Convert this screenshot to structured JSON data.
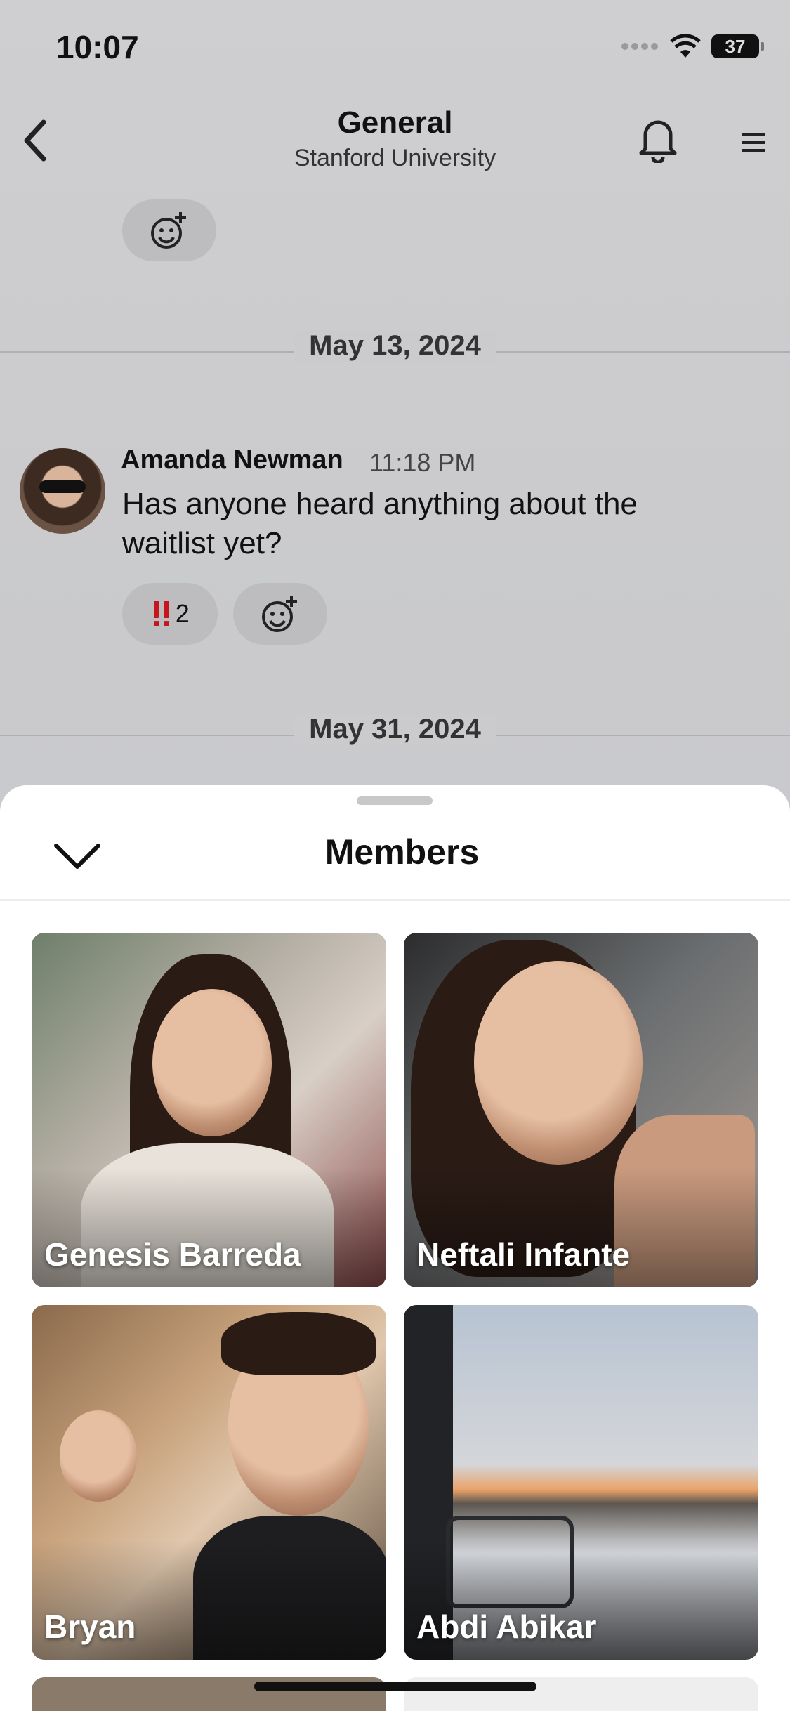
{
  "status_bar": {
    "time": "10:07",
    "battery": "37"
  },
  "header": {
    "title": "General",
    "subtitle": "Stanford University"
  },
  "chat": {
    "date_1": "May 13, 2024",
    "message": {
      "author": "Amanda Newman",
      "time": "11:18 PM",
      "text": "Has anyone heard anything about the waitlist yet?",
      "reaction_emoji": "‼",
      "reaction_count": "2"
    },
    "date_2": "May 31, 2024"
  },
  "sheet": {
    "title": "Members",
    "members": [
      {
        "name": "Genesis Barreda"
      },
      {
        "name": "Neftali Infante"
      },
      {
        "name": "Bryan"
      },
      {
        "name": "Abdi Abikar"
      }
    ]
  },
  "icons": {
    "back": "chevron-left-icon",
    "bell": "bell-icon",
    "menu": "hamburger-icon",
    "add_reaction": "smiley-plus-icon",
    "collapse": "chevron-down-icon"
  }
}
